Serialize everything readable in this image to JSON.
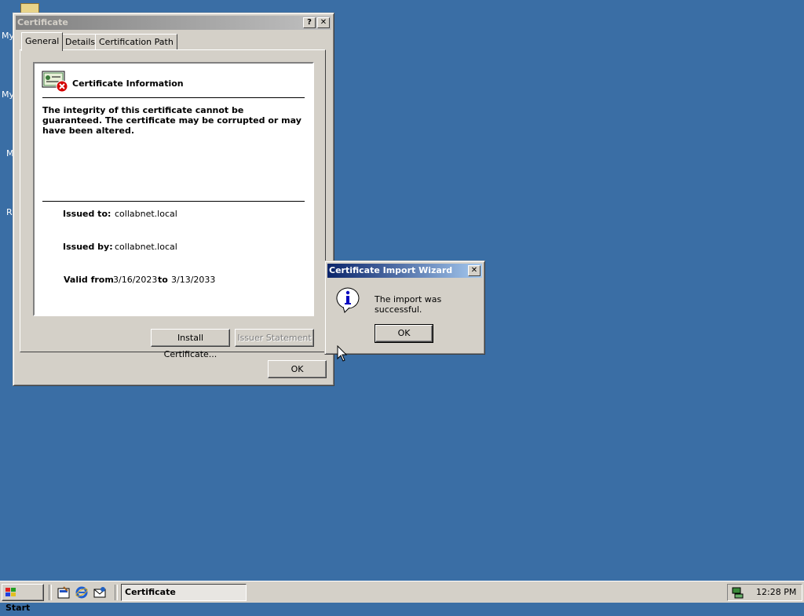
{
  "desktop": {
    "icon_labels": [
      "My",
      "My",
      "M",
      "R"
    ]
  },
  "cert_window": {
    "title": "Certificate",
    "help_glyph": "?",
    "close_glyph": "✕",
    "tabs": [
      "General",
      "Details",
      "Certification Path"
    ],
    "heading": "Certificate Information",
    "warning": "The integrity of this certificate cannot be guaranteed. The certificate may be corrupted or may have been altered.",
    "issued_to_label": "Issued to:",
    "issued_to_value": "collabnet.local",
    "issued_by_label": "Issued by:",
    "issued_by_value": "collabnet.local",
    "valid_from_label": "Valid from",
    "valid_from_value": "3/16/2023",
    "valid_to_label": "to",
    "valid_to_value": "3/13/2033",
    "install_button": "Install Certificate...",
    "issuer_button": "Issuer Statement",
    "ok_button": "OK"
  },
  "wizard_dialog": {
    "title": "Certificate Import Wizard",
    "close_glyph": "✕",
    "message": "The import was successful.",
    "ok_button": "OK",
    "info_icon_glyph": "i"
  },
  "taskbar": {
    "start_label": "Start",
    "task_label": "Certificate",
    "clock": "12:28 PM"
  },
  "colors": {
    "desktop": "#3a6ea5",
    "active_title": "#0a246a",
    "inactive_title": "#808080"
  }
}
